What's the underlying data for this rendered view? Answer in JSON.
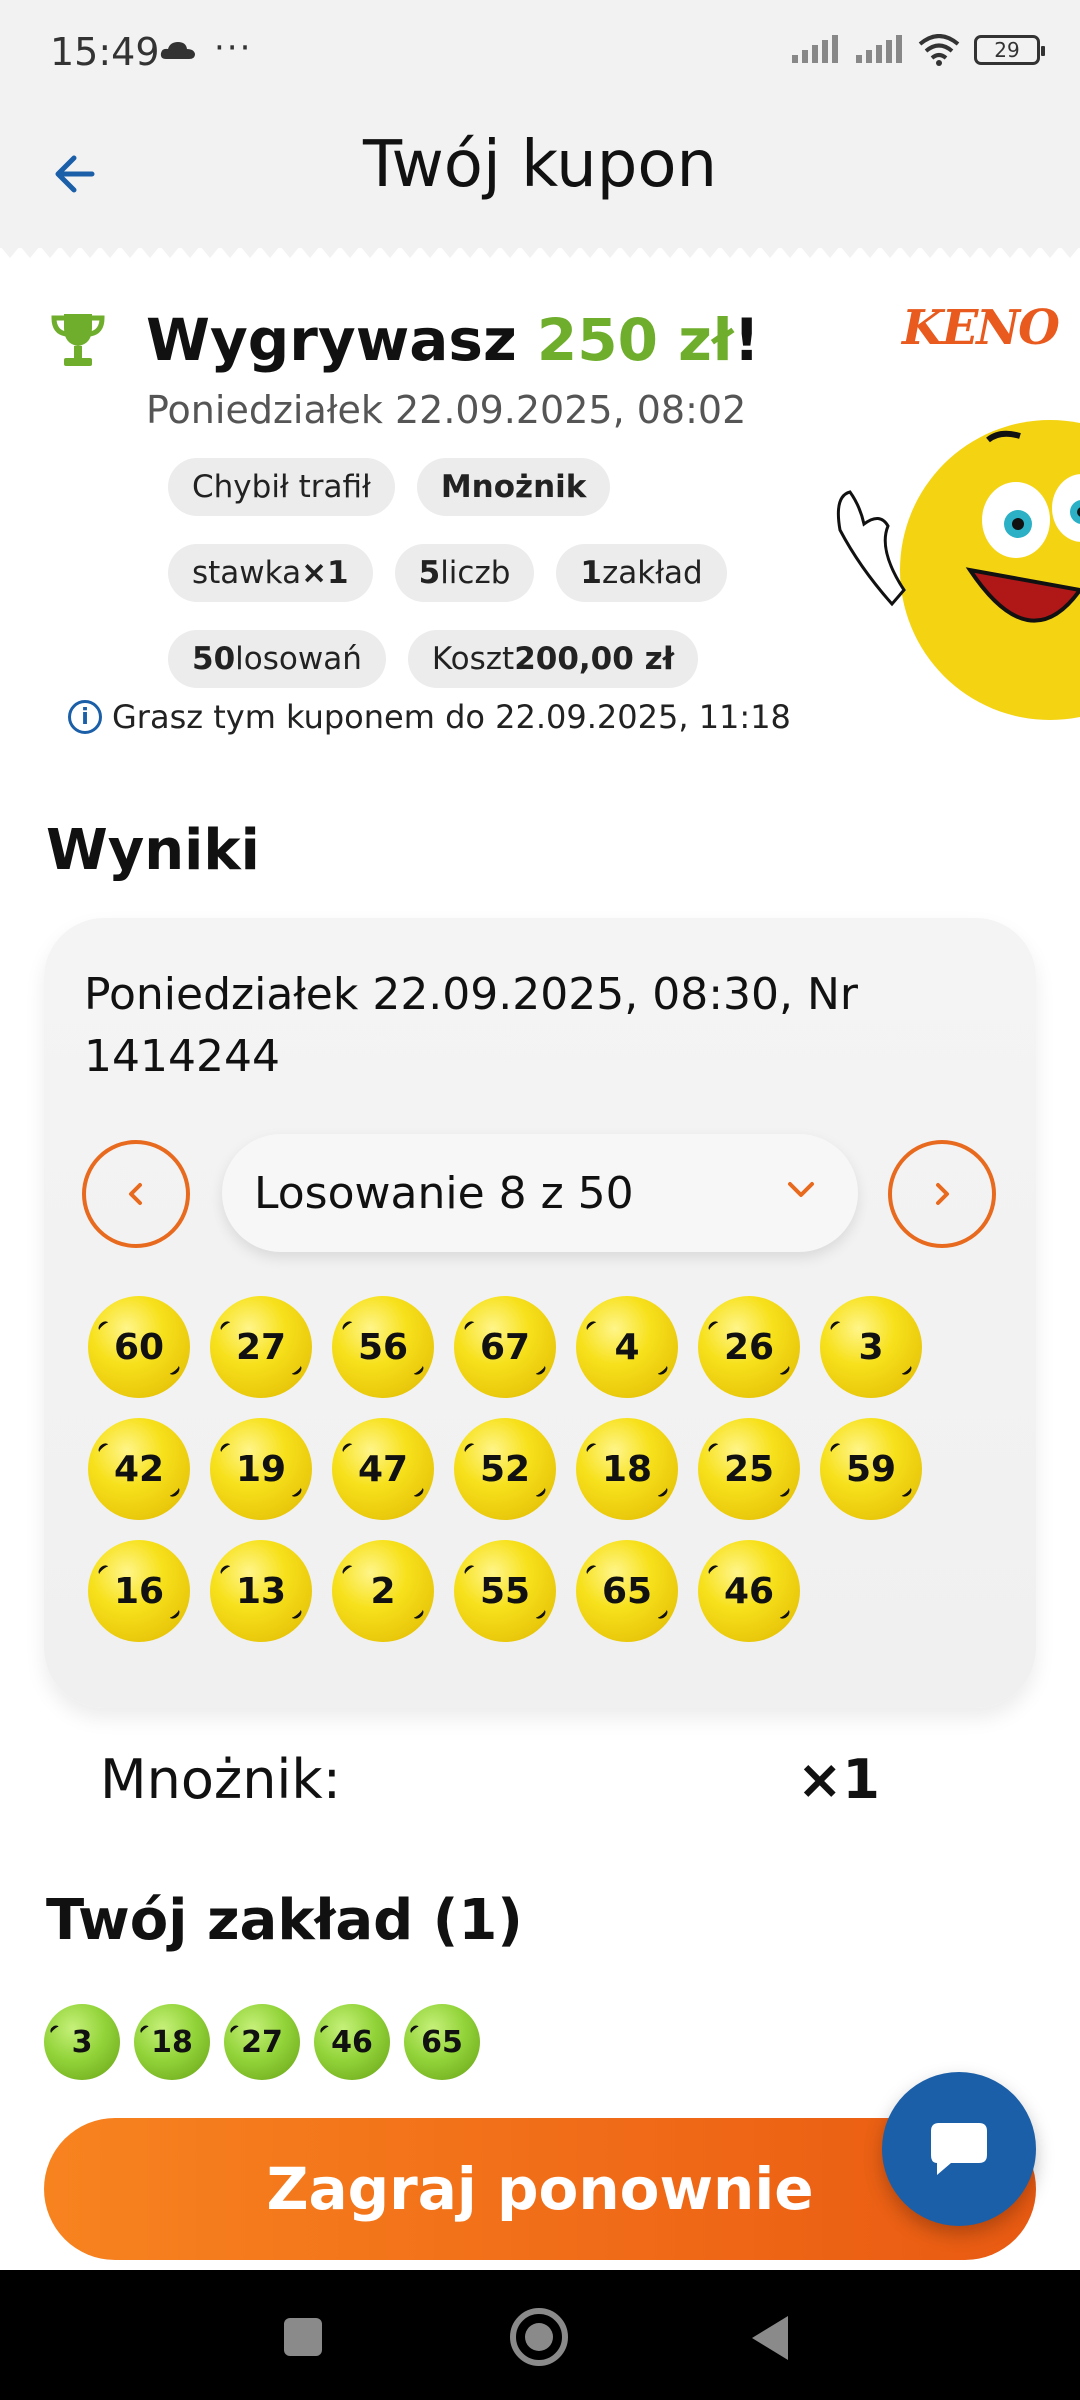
{
  "status_bar": {
    "time": "15:49",
    "dots": "···",
    "battery": "29"
  },
  "header": {
    "title": "Twój kupon"
  },
  "summary": {
    "win_prefix": "Wygrywasz ",
    "win_amount": "250 zł",
    "win_suffix": "!",
    "date": "Poniedziałek 22.09.2025, 08:02",
    "logo_text": "KENO",
    "chips": [
      {
        "label": "Chybił trafił"
      },
      {
        "bold": "Mnożnik"
      },
      {
        "label": "stawka ",
        "bold": "×1"
      },
      {
        "bold": "5",
        "label": " liczb"
      },
      {
        "bold": "1",
        "label": " zakład"
      },
      {
        "bold": "50",
        "label": " losowań"
      },
      {
        "label": "Koszt ",
        "bold": "200,00 zł"
      }
    ],
    "info_text": "Grasz tym kuponem do 22.09.2025, 11:18"
  },
  "results": {
    "section_title": "Wyniki",
    "draw_info": "Poniedziałek 22.09.2025, 08:30, Nr 1414244",
    "dropdown_selected": "Losowanie 8 z 50",
    "numbers": [
      60,
      27,
      56,
      67,
      4,
      26,
      3,
      42,
      19,
      47,
      52,
      18,
      25,
      59,
      16,
      13,
      2,
      55,
      65,
      46
    ]
  },
  "multiplier": {
    "label": "Mnożnik:",
    "value": "×1"
  },
  "bet": {
    "section_title": "Twój zakład (1)",
    "numbers": [
      3,
      18,
      27,
      46,
      65
    ]
  },
  "actions": {
    "play_again": "Zagraj ponownie"
  },
  "colors": {
    "accent_orange": "#f06a17",
    "brand_blue": "#1b5fa8",
    "win_green": "#6fae2c",
    "ball_yellow": "#f7e11c"
  }
}
